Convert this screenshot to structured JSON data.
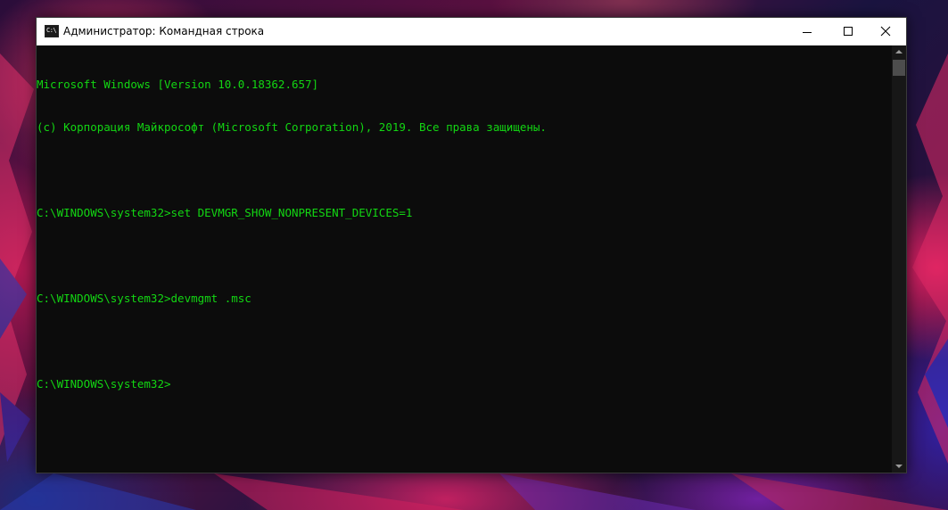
{
  "window": {
    "title": "Администратор: Командная строка",
    "app_icon": "cmd-icon",
    "app_icon_glyph": "C:\\",
    "controls": {
      "minimize_icon": "minimize-icon",
      "maximize_icon": "maximize-icon",
      "close_icon": "close-icon"
    }
  },
  "console": {
    "text_color": "#13d613",
    "background_color": "#0c0c0c",
    "lines": [
      "Microsoft Windows [Version 10.0.18362.657]",
      "(c) Корпорация Майкрософт (Microsoft Corporation), 2019. Все права защищены.",
      "",
      "C:\\WINDOWS\\system32>set DEVMGR_SHOW_NONPRESENT_DEVICES=1",
      "",
      "C:\\WINDOWS\\system32>devmgmt .msc",
      "",
      "C:\\WINDOWS\\system32>"
    ]
  },
  "scrollbar": {
    "up_icon": "scroll-up-arrow-icon",
    "down_icon": "scroll-down-arrow-icon"
  },
  "desktop": {
    "accent_colors": [
      "#d8305a",
      "#3020a0",
      "#5a1040",
      "#1a2a7a"
    ]
  }
}
